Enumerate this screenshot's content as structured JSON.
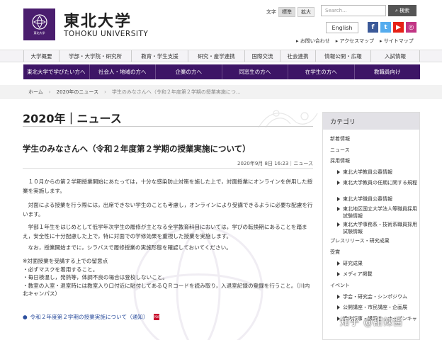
{
  "header": {
    "logo_small": "東北大学",
    "title_jp": "東北大学",
    "title_en": "TOHOKU UNIVERSITY",
    "fontsize_label": "文字",
    "fontsize_options": [
      "標準",
      "拡大"
    ],
    "search_placeholder": "Search...",
    "search_button": "検索",
    "english_button": "English",
    "sublinks": [
      "お問い合わせ",
      "アクセスマップ",
      "サイトマップ"
    ]
  },
  "nav_primary": [
    "大学概要",
    "学部・大学院・研究所",
    "教育・学生支援",
    "研究・産学連携",
    "国際交流",
    "社会連携",
    "情報公開・広報",
    "入試情報"
  ],
  "nav_secondary": [
    "東北大学で学びたい方へ",
    "社会人・地域の方へ",
    "企業の方へ",
    "同窓生の方へ",
    "在学生の方へ",
    "教職員向け"
  ],
  "breadcrumb": [
    "ホーム",
    "2020年のニュース",
    "学生のみなさんへ（令和２年度第２学期の授業実施につ..."
  ],
  "main": {
    "page_title": "2020年｜ニュース",
    "article_title": "学生のみなさんへ（令和２年度第２学期の授業実施について）",
    "date": "2020年9月 8日 16:23｜ニュース",
    "para1": "　１０月からの第２学期授業開始にあたっては，十分な感染防止対策を施した上で，対面授業にオンラインを併用した授業を実施します。",
    "para2": "　対面による授業を行う際には，出席できない学生のことも考慮し，オンラインにより受講できるように必要な配慮を行います。",
    "para3": "　学部１年生をはじめとして低学年次学生の履修が主となる全学教育科目においては，学びの転換期にあることを踏まえ，安全性に十分配慮した上で，特に対面での学修効果を重視した授業を実施します。",
    "para4": "　なお，授業開始までに，シラバスで履修授業の実施形態を確認しておいてください。",
    "notes": [
      "※対面授業を受講する上での留意点",
      "・必ずマスクを着用すること。",
      "・毎日検温し，発熱等，体調不良の場合は登校しないこと。",
      "・教室の入室・退室時には教室入り口付近に貼付してあるＱＲコードを読み取り，入退室記録の登録を行うこと。（川内北キャンパス）"
    ],
    "pdf_link": "令和２年度第２学期の授業実施について（通知）",
    "pdf_icon_text": "PDF"
  },
  "sidebar": {
    "title": "カテゴリ",
    "items": [
      {
        "label": "新着情報",
        "sub": false
      },
      {
        "label": "ニュース",
        "sub": false
      },
      {
        "label": "採用情報",
        "sub": false
      },
      {
        "label": "東北大学教員公募情報",
        "sub": true
      },
      {
        "label": "東北大学教員の任期に関する規程",
        "sub": true,
        "two": true
      },
      {
        "label": "東北大学職員公募情報",
        "sub": true
      },
      {
        "label": "東北地区国立大学法人等職員採用試験情報",
        "sub": true,
        "two": true
      },
      {
        "label": "東北大学事務系・技術系職員採用試験情報",
        "sub": true,
        "two": true
      },
      {
        "label": "プレスリリース・研究成果",
        "sub": false
      },
      {
        "label": "受賞",
        "sub": false
      },
      {
        "label": "研究成果",
        "sub": true
      },
      {
        "label": "メディア掲載",
        "sub": true
      },
      {
        "label": "イベント",
        "sub": false
      },
      {
        "label": "学会・研究会・シンポジウム",
        "sub": true
      },
      {
        "label": "公開講座・市民講座・企画展",
        "sub": true
      },
      {
        "label": "学内行事・講習会・オープンキャ",
        "sub": true
      }
    ]
  },
  "watermark": "知乎 @甜辣酱",
  "colors": {
    "brand": "#3d1566",
    "link": "#2d4f9e"
  }
}
